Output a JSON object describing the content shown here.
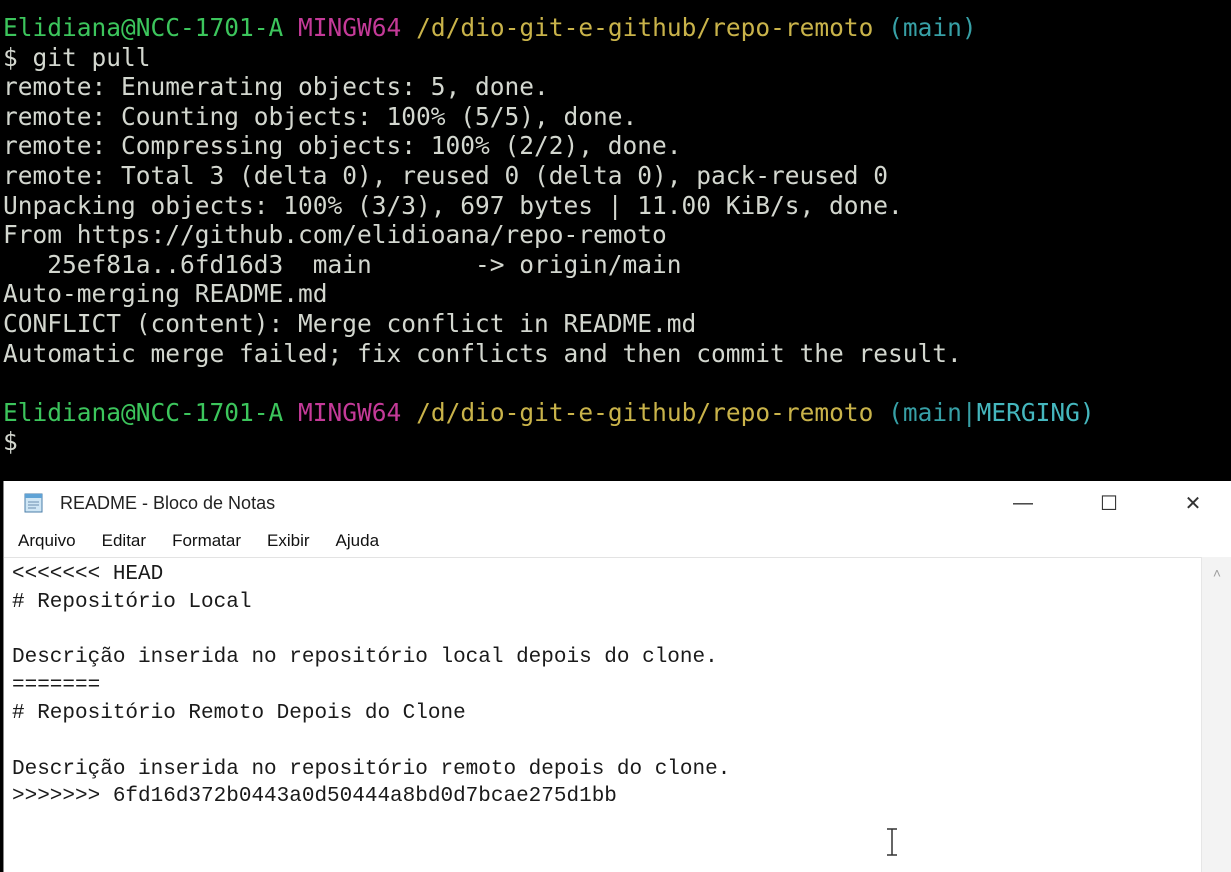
{
  "terminal": {
    "prompt1": {
      "user": "Elidiana@NCC-1701-A",
      "system": "MINGW64",
      "path": "/d/dio-git-e-github/repo-remoto",
      "branch": "(main)"
    },
    "command": "$ git pull",
    "output": [
      "remote: Enumerating objects: 5, done.",
      "remote: Counting objects: 100% (5/5), done.",
      "remote: Compressing objects: 100% (2/2), done.",
      "remote: Total 3 (delta 0), reused 0 (delta 0), pack-reused 0",
      "Unpacking objects: 100% (3/3), 697 bytes | 11.00 KiB/s, done.",
      "From https://github.com/elidioana/repo-remoto",
      "   25ef81a..6fd16d3  main       -> origin/main",
      "Auto-merging README.md",
      "CONFLICT (content): Merge conflict in README.md",
      "Automatic merge failed; fix conflicts and then commit the result."
    ],
    "prompt2": {
      "user": "Elidiana@NCC-1701-A",
      "system": "MINGW64",
      "path": "/d/dio-git-e-github/repo-remoto",
      "branch_open": "(main",
      "branch_sep": "|",
      "branch_state": "MERGING)"
    },
    "cursor_prompt": "$"
  },
  "notepad": {
    "title": "README - Bloco de Notas",
    "controls": {
      "minimize": "—",
      "maximize": "☐",
      "close": "✕"
    },
    "menu": [
      "Arquivo",
      "Editar",
      "Formatar",
      "Exibir",
      "Ajuda"
    ],
    "lines": [
      "<<<<<<< HEAD",
      "# Repositório Local",
      "",
      "Descrição inserida no repositório local depois do clone.",
      "=======",
      "# Repositório Remoto Depois do Clone",
      "",
      "Descrição inserida no repositório remoto depois do clone.",
      ">>>>>>> 6fd16d372b0443a0d50444a8bd0d7bcae275d1bb"
    ],
    "scroll_up_glyph": "˄"
  },
  "icons": {
    "app": "notepad-icon",
    "cursor": "text-ibeam-cursor"
  }
}
